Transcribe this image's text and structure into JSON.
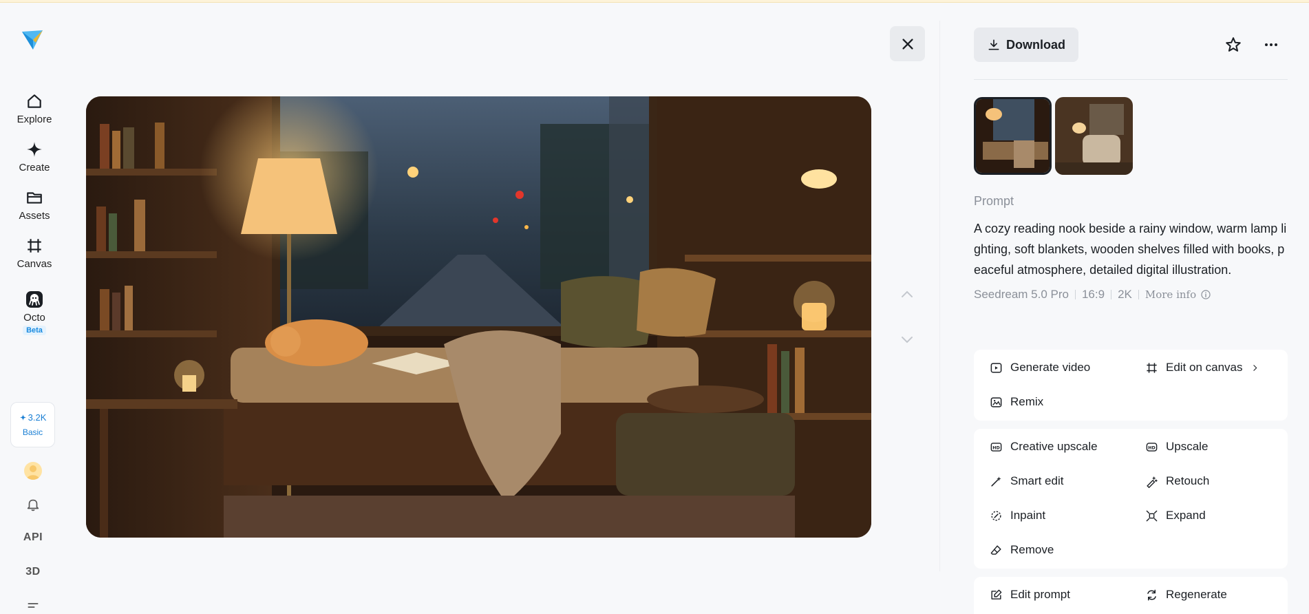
{
  "nav": {
    "items": [
      {
        "label": "Explore",
        "icon": "home-icon"
      },
      {
        "label": "Create",
        "icon": "sparkle-icon"
      },
      {
        "label": "Assets",
        "icon": "folder-icon"
      },
      {
        "label": "Canvas",
        "icon": "canvas-icon"
      },
      {
        "label": "Octo",
        "icon": "octo-icon",
        "badge": "Beta"
      }
    ],
    "credits": {
      "amount": "3.2K",
      "plan": "Basic"
    },
    "api_label": "API",
    "three_d_label": "3D"
  },
  "toolbar": {
    "download_label": "Download"
  },
  "prompt": {
    "label": "Prompt",
    "text": "A cozy reading nook beside a rainy window, warm lamp lighting, soft blankets, wooden shelves filled with books, peaceful atmosphere, detailed digital illustration.",
    "model": "Seedream 5.0 Pro",
    "ratio": "16:9",
    "resolution": "2K",
    "more_info": "More info"
  },
  "actions": {
    "group1": [
      {
        "label": "Generate video",
        "icon": "video-icon"
      },
      {
        "label": "Edit on canvas",
        "icon": "canvas-icon"
      },
      {
        "label": "Remix",
        "icon": "remix-icon"
      }
    ],
    "group2": [
      {
        "label": "Creative upscale",
        "icon": "hd-plus-icon"
      },
      {
        "label": "Upscale",
        "icon": "hd-icon"
      },
      {
        "label": "Smart edit",
        "icon": "magic-wand-icon"
      },
      {
        "label": "Retouch",
        "icon": "retouch-icon"
      },
      {
        "label": "Inpaint",
        "icon": "inpaint-icon"
      },
      {
        "label": "Expand",
        "icon": "expand-icon"
      },
      {
        "label": "Remove",
        "icon": "eraser-icon"
      }
    ],
    "group3": [
      {
        "label": "Edit prompt",
        "icon": "edit-prompt-icon"
      },
      {
        "label": "Regenerate",
        "icon": "regenerate-icon"
      }
    ]
  },
  "colors": {
    "accent": "#1a8be0",
    "panel": "#ffffff",
    "background": "#f7f8fa"
  }
}
